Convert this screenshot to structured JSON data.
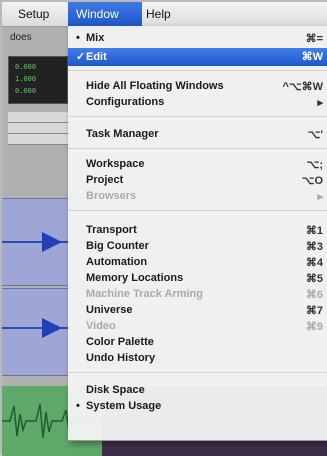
{
  "menubar": {
    "items": [
      {
        "label": "Setup"
      },
      {
        "label": "Window"
      },
      {
        "label": "Help"
      }
    ]
  },
  "app": {
    "tool_label": "does",
    "counter_digits": [
      "0.000",
      "1.000",
      "0.000"
    ]
  },
  "window_menu": {
    "items": [
      {
        "mark": "•",
        "label": "Mix",
        "shortcut": "⌘="
      },
      {
        "mark": "✓",
        "label": "Edit",
        "shortcut": "⌘W"
      },
      {
        "mark": "",
        "label": "Hide All Floating Windows",
        "shortcut": "^⌥⌘W"
      },
      {
        "mark": "",
        "label": "Configurations",
        "shortcut": "▸"
      },
      {
        "mark": "",
        "label": "Task Manager",
        "shortcut": "⌥'"
      },
      {
        "mark": "",
        "label": "Workspace",
        "shortcut": "⌥;"
      },
      {
        "mark": "",
        "label": "Project",
        "shortcut": "⌥O"
      },
      {
        "mark": "",
        "label": "Browsers",
        "shortcut": "▸"
      },
      {
        "mark": "",
        "label": "Transport",
        "shortcut": "⌘1"
      },
      {
        "mark": "",
        "label": "Big Counter",
        "shortcut": "⌘3"
      },
      {
        "mark": "",
        "label": "Automation",
        "shortcut": "⌘4"
      },
      {
        "mark": "",
        "label": "Memory Locations",
        "shortcut": "⌘5"
      },
      {
        "mark": "",
        "label": "Machine Track Arming",
        "shortcut": "⌘6"
      },
      {
        "mark": "",
        "label": "Universe",
        "shortcut": "⌘7"
      },
      {
        "mark": "",
        "label": "Video",
        "shortcut": "⌘9"
      },
      {
        "mark": "",
        "label": "Color Palette",
        "shortcut": ""
      },
      {
        "mark": "",
        "label": "Undo History",
        "shortcut": ""
      },
      {
        "mark": "",
        "label": "Disk Space",
        "shortcut": ""
      },
      {
        "mark": "•",
        "label": "System Usage",
        "shortcut": ""
      }
    ]
  },
  "colors": {
    "selection": "#2f6ee0",
    "track_lane": "#9ea6d6",
    "audio_lane": "#5ea86a"
  }
}
